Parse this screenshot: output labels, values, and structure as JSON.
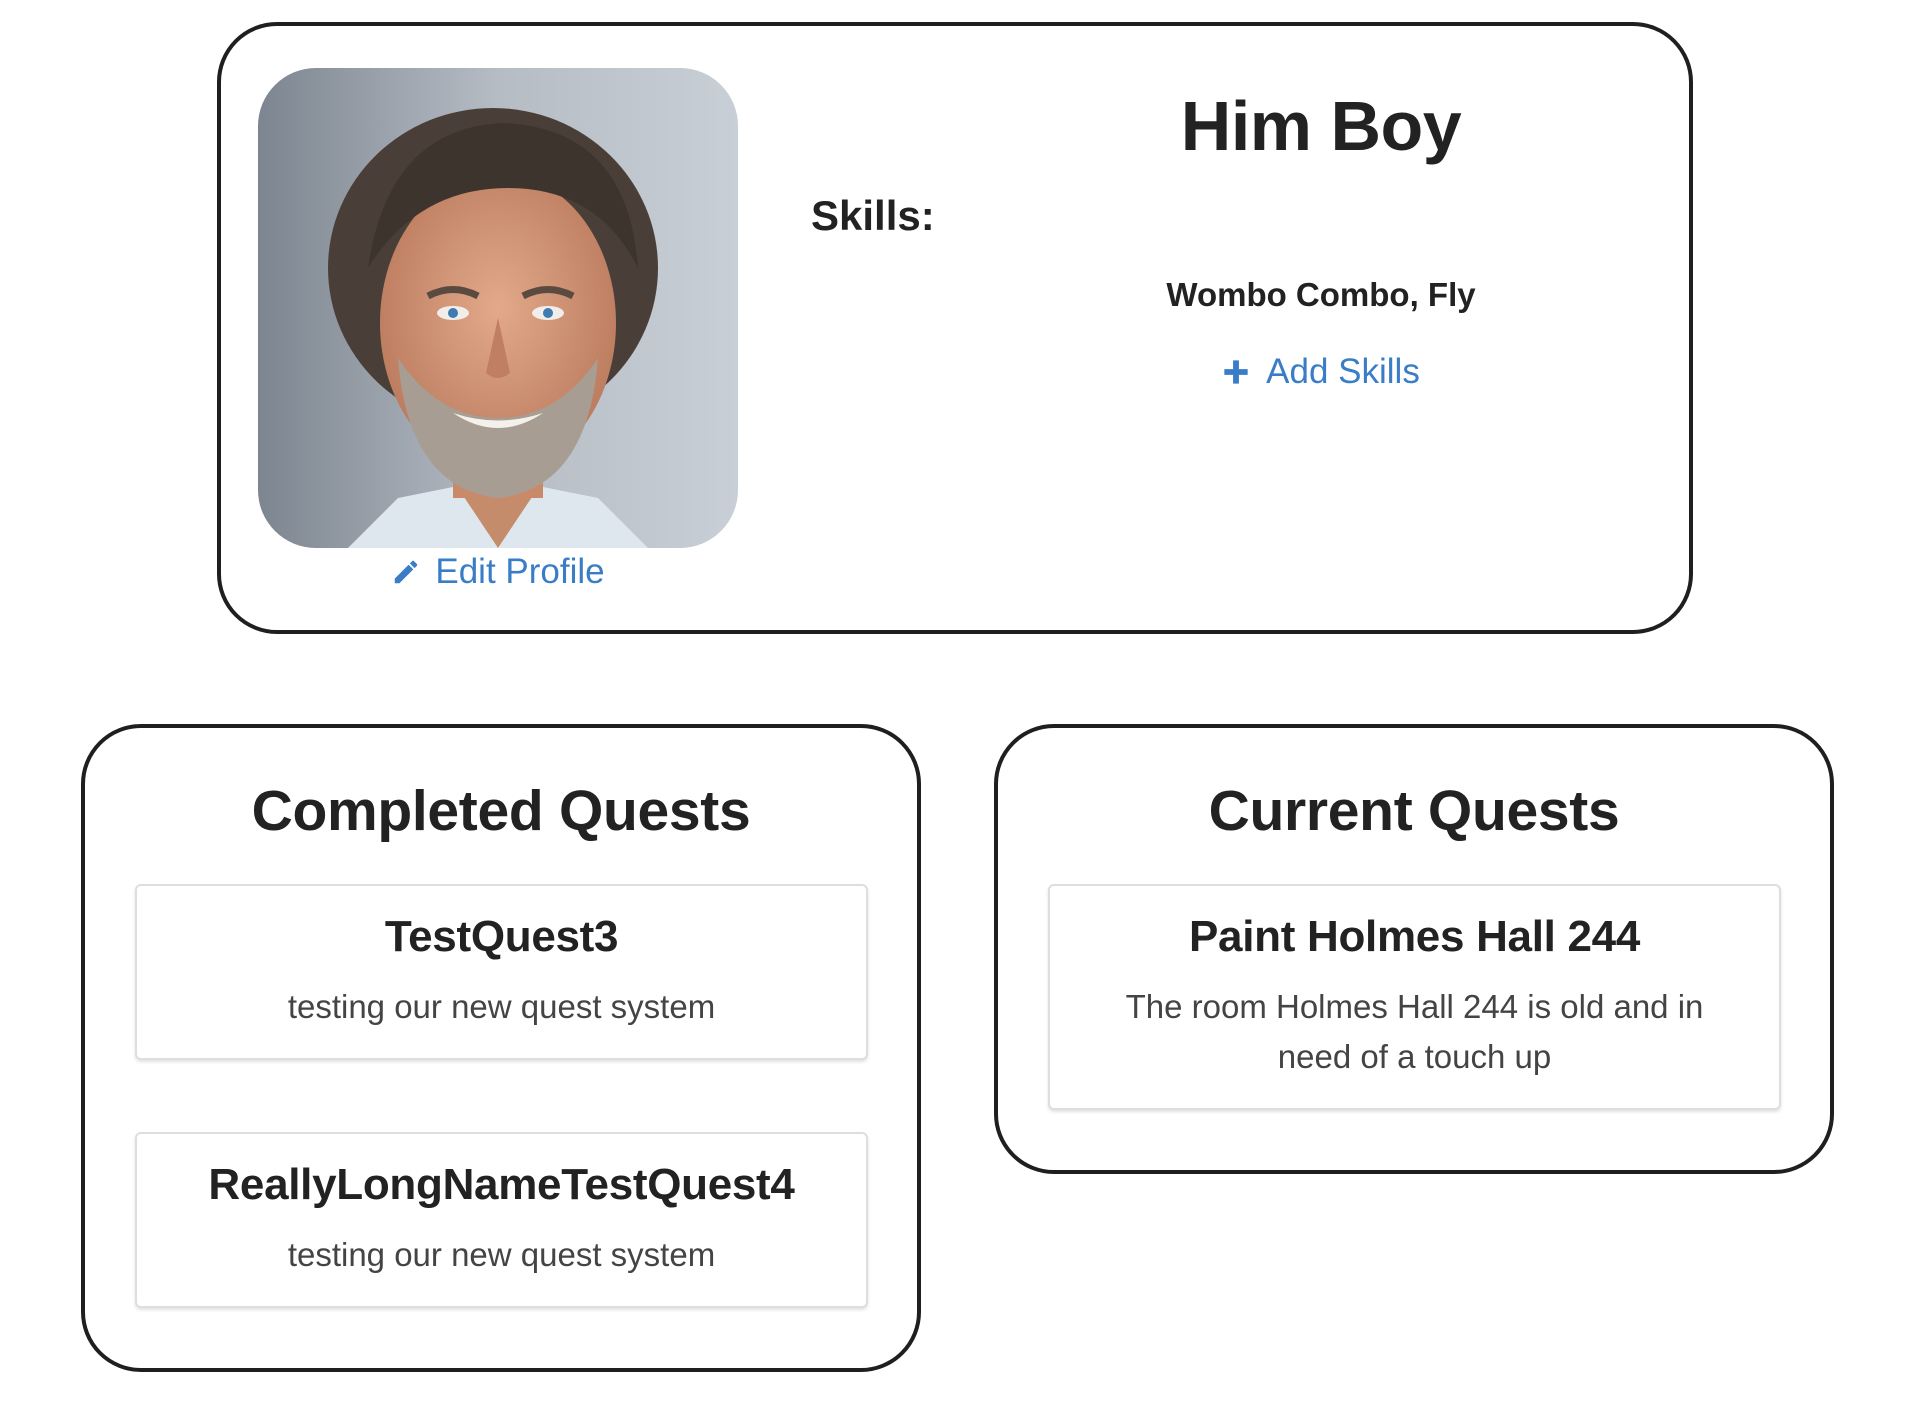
{
  "profile": {
    "name": "Him Boy",
    "edit_label": "Edit Profile",
    "skills_heading": "Skills:",
    "skills_text": "Wombo Combo, Fly",
    "add_skills_label": "Add Skills"
  },
  "completed": {
    "title": "Completed Quests",
    "quests": [
      {
        "title": "TestQuest3",
        "description": "testing our new quest system"
      },
      {
        "title": "ReallyLongNameTestQuest4",
        "description": "testing our new quest system"
      }
    ]
  },
  "current": {
    "title": "Current Quests",
    "quests": [
      {
        "title": "Paint Holmes Hall 244",
        "description": "The room Holmes Hall 244 is old and in need of a touch up"
      }
    ]
  },
  "colors": {
    "link": "#3a7dc7",
    "border": "#1f1f1f",
    "text": "#222222"
  },
  "icons": {
    "edit": "pencil-icon",
    "add": "plus-icon"
  }
}
